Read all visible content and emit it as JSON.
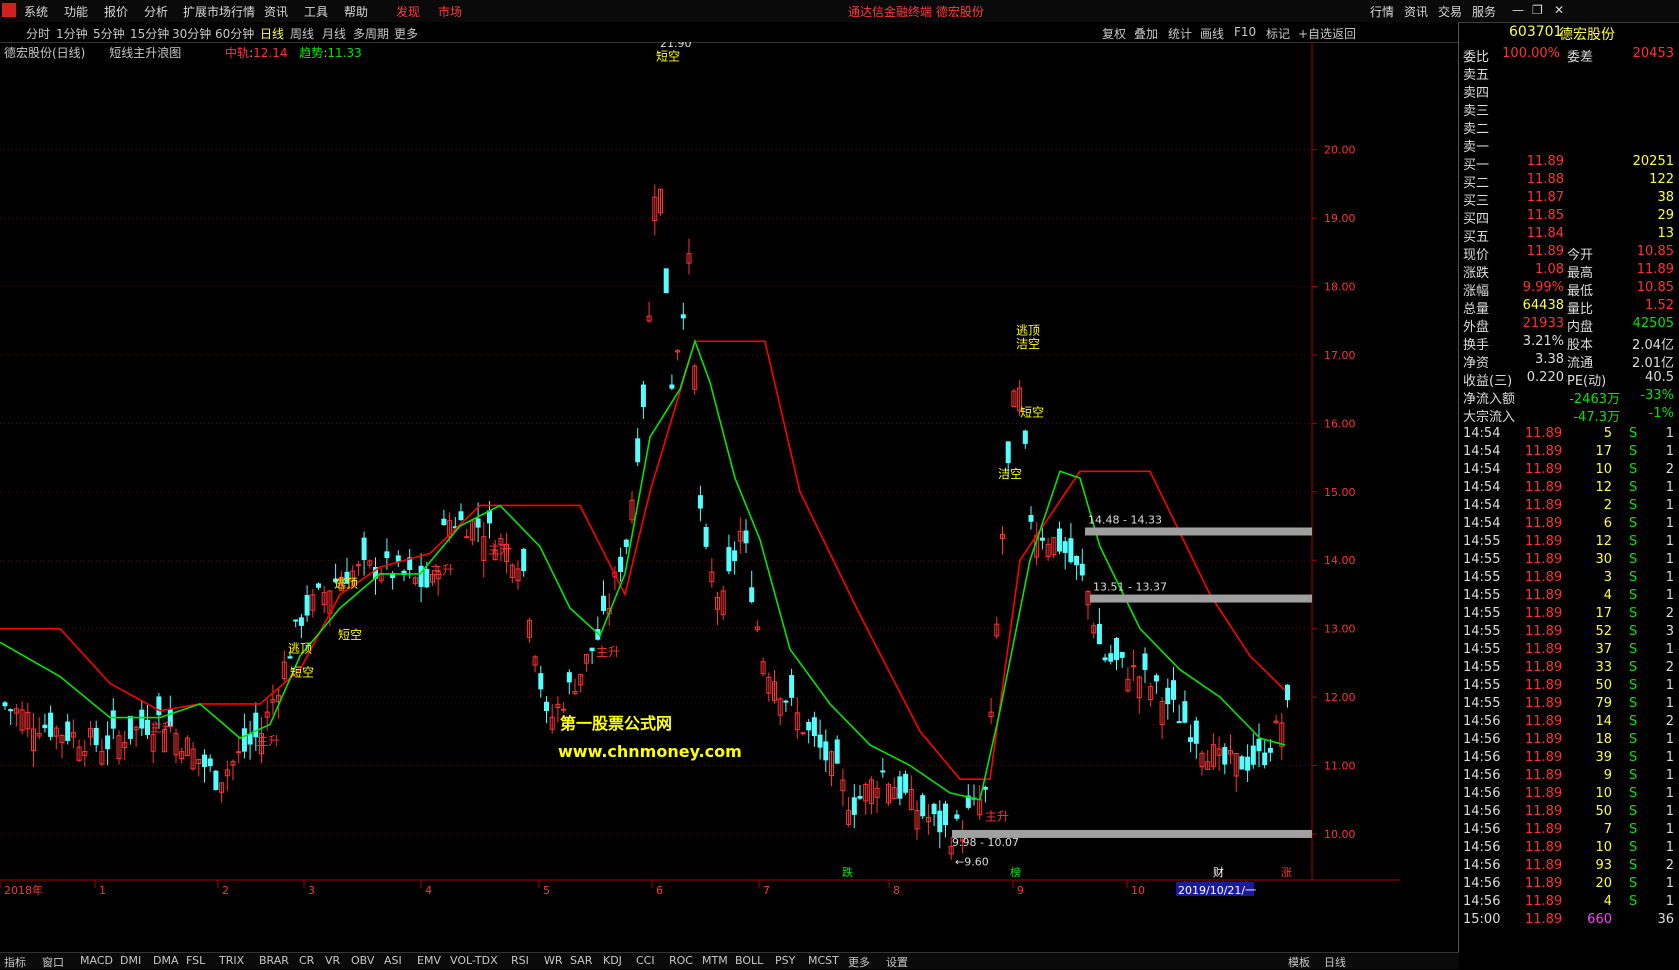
{
  "menubar": {
    "items": [
      "系统",
      "功能",
      "报价",
      "分析",
      "扩展市场行情",
      "资讯",
      "工具",
      "帮助"
    ],
    "hot1": "发现",
    "hot2": "市场",
    "center": "通达信金融终端  德宏股份",
    "right": [
      "行情",
      "资讯",
      "交易",
      "服务"
    ]
  },
  "toolbar": {
    "periods": [
      "分时",
      "1分钟",
      "5分钟",
      "15分钟",
      "30分钟",
      "60分钟",
      "日线",
      "周线",
      "月线",
      "多周期",
      "更多"
    ],
    "right": [
      "复权",
      "叠加",
      "统计",
      "画线",
      "F10",
      "标记",
      "+自选",
      "返回"
    ]
  },
  "chart_header": {
    "stock": "德宏股份(日线)",
    "indicator": "短线主升浪图",
    "mid_label": "中轨",
    "mid_value": "12.14",
    "trend_label": "趋势",
    "trend_value": "11.33"
  },
  "chart_data": {
    "type": "line",
    "ylim": [
      9.4,
      21.5
    ],
    "yticks": [
      "20.00",
      "19.00",
      "18.00",
      "17.00",
      "16.00",
      "15.00",
      "14.00",
      "13.00",
      "12.00",
      "11.00",
      "10.00"
    ],
    "x_labels": [
      "2018年",
      "1",
      "2",
      "3",
      "4",
      "5",
      "6",
      "7",
      "8",
      "9",
      "10"
    ],
    "selected_date": "2019/10/21/一",
    "markers": [
      "逃顶",
      "短空",
      "逃顶",
      "短空",
      "主升",
      "主升",
      "主升",
      "主升",
      "短空",
      "主升",
      "逃顶",
      "洁空",
      "短空",
      "洁空",
      "主升"
    ],
    "peak_label": "21.90",
    "low_label": "9.60",
    "zones": [
      "14.48 - 14.33",
      "13.51 - 13.37",
      "9.98 - 10.07"
    ],
    "bottom_tags": [
      "跌",
      "榜",
      "财",
      "涨"
    ],
    "watermark1": "第一股票公式网",
    "watermark2": "www.chnmoney.com"
  },
  "quote": {
    "code": "603701",
    "name": "德宏股份",
    "wb_label": "委比",
    "wb": "100.00%",
    "wc_label": "委差",
    "wc": "20453",
    "sells": [
      "卖五",
      "卖四",
      "卖三",
      "卖二",
      "卖一"
    ],
    "buys": [
      [
        "买一",
        "11.89",
        "20251"
      ],
      [
        "买二",
        "11.88",
        "122"
      ],
      [
        "买三",
        "11.87",
        "38"
      ],
      [
        "买四",
        "11.85",
        "29"
      ],
      [
        "买五",
        "11.84",
        "13"
      ]
    ],
    "stats": [
      [
        "现价",
        "11.89",
        "今开",
        "10.85"
      ],
      [
        "涨跌",
        "1.08",
        "最高",
        "11.89"
      ],
      [
        "涨幅",
        "9.99%",
        "最低",
        "10.85"
      ],
      [
        "总量",
        "64438",
        "量比",
        "1.52"
      ],
      [
        "外盘",
        "21933",
        "内盘",
        "42505"
      ]
    ],
    "stats2": [
      [
        "换手",
        "3.21%",
        "股本",
        "2.04亿"
      ],
      [
        "净资",
        "3.38",
        "流通",
        "2.01亿"
      ],
      [
        "收益(三)",
        "0.220",
        "PE(动)",
        "40.5"
      ]
    ],
    "flow": [
      [
        "净流入额",
        "-2463万",
        "-33%"
      ],
      [
        "大宗流入",
        "-47.3万",
        "-1%"
      ]
    ],
    "ticks": [
      [
        "14:54",
        "11.89",
        "5",
        "S",
        "1"
      ],
      [
        "14:54",
        "11.89",
        "17",
        "S",
        "1"
      ],
      [
        "14:54",
        "11.89",
        "10",
        "S",
        "2"
      ],
      [
        "14:54",
        "11.89",
        "12",
        "S",
        "1"
      ],
      [
        "14:54",
        "11.89",
        "2",
        "S",
        "1"
      ],
      [
        "14:54",
        "11.89",
        "6",
        "S",
        "1"
      ],
      [
        "14:55",
        "11.89",
        "12",
        "S",
        "1"
      ],
      [
        "14:55",
        "11.89",
        "30",
        "S",
        "1"
      ],
      [
        "14:55",
        "11.89",
        "3",
        "S",
        "1"
      ],
      [
        "14:55",
        "11.89",
        "4",
        "S",
        "1"
      ],
      [
        "14:55",
        "11.89",
        "17",
        "S",
        "2"
      ],
      [
        "14:55",
        "11.89",
        "52",
        "S",
        "3"
      ],
      [
        "14:55",
        "11.89",
        "37",
        "S",
        "1"
      ],
      [
        "14:55",
        "11.89",
        "33",
        "S",
        "2"
      ],
      [
        "14:55",
        "11.89",
        "50",
        "S",
        "1"
      ],
      [
        "14:55",
        "11.89",
        "79",
        "S",
        "1"
      ],
      [
        "14:56",
        "11.89",
        "14",
        "S",
        "2"
      ],
      [
        "14:56",
        "11.89",
        "18",
        "S",
        "1"
      ],
      [
        "14:56",
        "11.89",
        "39",
        "S",
        "1"
      ],
      [
        "14:56",
        "11.89",
        "9",
        "S",
        "1"
      ],
      [
        "14:56",
        "11.89",
        "10",
        "S",
        "1"
      ],
      [
        "14:56",
        "11.89",
        "50",
        "S",
        "1"
      ],
      [
        "14:56",
        "11.89",
        "7",
        "S",
        "1"
      ],
      [
        "14:56",
        "11.89",
        "10",
        "S",
        "1"
      ],
      [
        "14:56",
        "11.89",
        "93",
        "S",
        "2"
      ],
      [
        "14:56",
        "11.89",
        "20",
        "S",
        "1"
      ],
      [
        "14:56",
        "11.89",
        "4",
        "S",
        "1"
      ],
      [
        "15:00",
        "11.89",
        "660",
        "",
        "36"
      ]
    ]
  },
  "bottombar": {
    "items": [
      "指标",
      "窗口",
      "MACD",
      "DMI",
      "DMA",
      "FSL",
      "TRIX",
      "BRAR",
      "CR",
      "VR",
      "OBV",
      "ASI",
      "EMV",
      "VOL-TDX",
      "RSI",
      "WR",
      "SAR",
      "KDJ",
      "CCI",
      "ROC",
      "MTM",
      "BOLL",
      "PSY",
      "MCST",
      "更多",
      "设置"
    ],
    "right": [
      "模板",
      "日线"
    ]
  },
  "colors": {
    "up": "#ff3232",
    "down": "#54ffff",
    "mid": "#00e600",
    "trend": "#ff0000",
    "zone": "#a0a0a0",
    "accent": "#ffff00"
  }
}
